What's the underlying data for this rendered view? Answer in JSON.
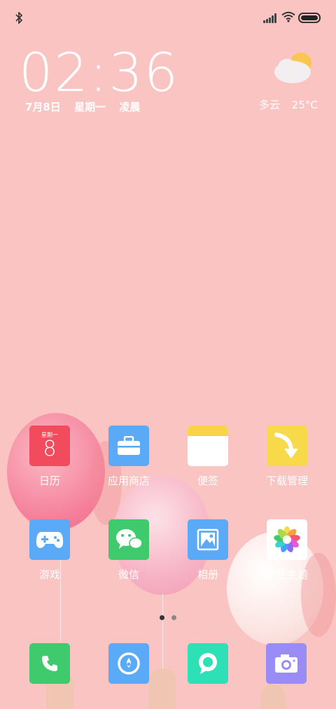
{
  "status": {
    "bluetooth_icon": "bluetooth-icon",
    "signal_icon": "signal-icon",
    "wifi_icon": "wifi-icon",
    "battery_icon": "battery-icon"
  },
  "clock": {
    "time": "02:36",
    "date": "7月8日 星期一 凌晨"
  },
  "weather": {
    "icon": "partly-cloudy-icon",
    "text": "多云 25°C"
  },
  "apps": [
    {
      "label": "日历",
      "icon": "calendar-icon",
      "color": "#f24b5d",
      "weekday": "星期一",
      "day": "8"
    },
    {
      "label": "应用商店",
      "icon": "briefcase-icon",
      "color": "#5aaaf8"
    },
    {
      "label": "便签",
      "icon": "notes-icon",
      "color": "#ffffff"
    },
    {
      "label": "下载管理",
      "icon": "download-arrow-icon",
      "color": "#f7d949"
    },
    {
      "label": "游戏",
      "icon": "gamepad-icon",
      "color": "#5aaaf8"
    },
    {
      "label": "微信",
      "icon": "wechat-icon",
      "color": "#3fcb6d"
    },
    {
      "label": "相册",
      "icon": "gallery-icon",
      "color": "#5aaaf8"
    },
    {
      "label": "个性主题",
      "icon": "theme-flower-icon",
      "color": "#ffffff"
    }
  ],
  "page_indicator": {
    "pages": 2,
    "current": 1
  },
  "dock": [
    {
      "icon": "phone-icon",
      "color": "#3fcb6d"
    },
    {
      "icon": "browser-icon",
      "color": "#5aaaf8"
    },
    {
      "icon": "messages-icon",
      "color": "#2ee0b6"
    },
    {
      "icon": "camera-icon",
      "color": "#9a8cf6"
    }
  ]
}
